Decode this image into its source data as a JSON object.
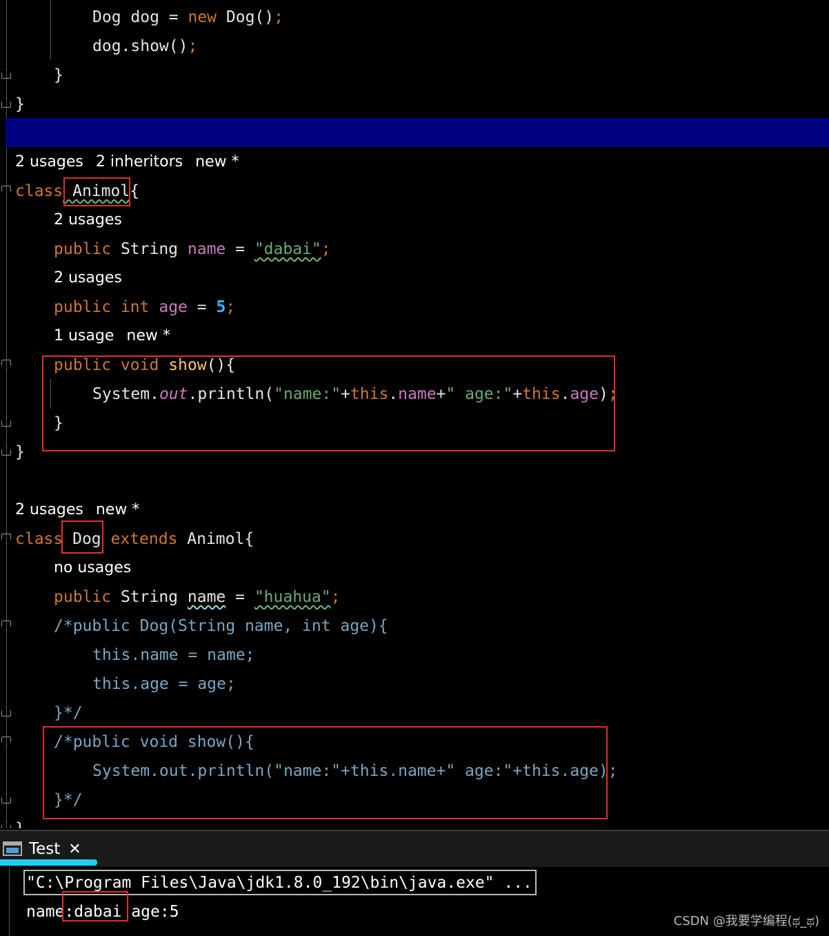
{
  "editor": {
    "top": {
      "l1": [
        "Dog dog = ",
        "new",
        " Dog()",
        ";"
      ],
      "l2": [
        "dog.show()",
        ";"
      ],
      "l3": "}",
      "l4": "}"
    },
    "animol": {
      "hint": [
        "2 usages",
        "2 inheritors",
        "new *"
      ],
      "decl": [
        "class",
        " Animol",
        "{"
      ],
      "hint_name": "2 usages",
      "name_line": [
        "public",
        " String ",
        "name",
        " = ",
        "\"dabai\"",
        ";"
      ],
      "hint_age": "2 usages",
      "age_line": [
        "public int",
        " ",
        "age",
        " = ",
        "5",
        ";"
      ],
      "hint_show": [
        "1 usage",
        "new *"
      ],
      "show_decl": [
        "public void",
        " ",
        "show",
        "(){"
      ],
      "println": [
        "System.",
        "out",
        ".println(",
        "\"name:\"",
        "+",
        "this",
        ".",
        "name",
        "+",
        "\" age:\"",
        "+",
        "this",
        ".",
        "age",
        ")",
        ";"
      ],
      "close_method": "}",
      "close_class": "}"
    },
    "dog": {
      "hint": [
        "2 usages",
        "new *"
      ],
      "decl": [
        "class",
        " Dog",
        " extends",
        " Animol{"
      ],
      "hint_name": "no usages",
      "name_line": [
        "public",
        " String ",
        "name",
        " = ",
        "\"huahua\"",
        ";"
      ],
      "c1": "/*public Dog(String name, int age){",
      "c2": "this.name = name;",
      "c3": "this.age = age;",
      "c4": "}*/",
      "c5": "/*public void show(){",
      "c6": "System.out.println(\"name:\"+this.name+\" age:\"+this.age);",
      "c7": "}*/",
      "close_class": "}"
    }
  },
  "run_panel": {
    "tab_label": "Test",
    "close_glyph": "✕",
    "cmd": "\"C:\\Program Files\\Java\\jdk1.8.0_192\\bin\\java.exe\" ...",
    "output": [
      "name",
      ":dabai",
      " age:5"
    ]
  },
  "watermark": "CSDN @我要学编程(ಥ_ಥ)",
  "colors": {
    "keyword": "#cc7832",
    "field": "#c77dbb",
    "string": "#6aab73",
    "number": "#3fb4ff",
    "comment": "#7aa6c2",
    "highlight_band": "#000080",
    "annotation_box": "#e03030",
    "tab_accent": "#20d0f0"
  }
}
